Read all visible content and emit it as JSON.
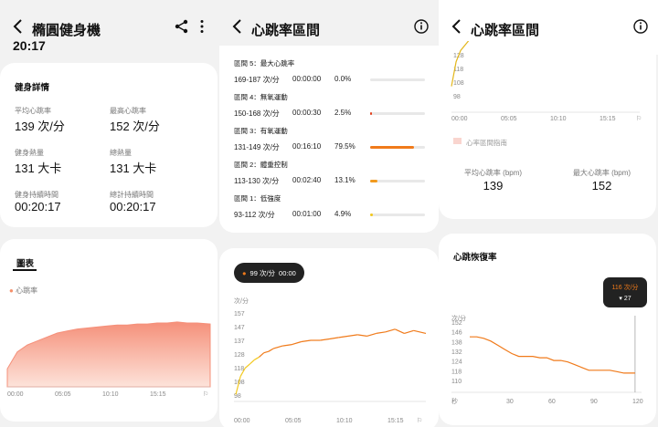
{
  "panel1": {
    "title": "橢圓健身機",
    "clipped_time": "20:17",
    "details": {
      "heading": "健身詳情",
      "avg_hr_label": "平均心跳率",
      "avg_hr_value": "139 次/分",
      "max_hr_label": "最高心跳率",
      "max_hr_value": "152 次/分",
      "calories_label": "健身熱量",
      "calories_value": "131 大卡",
      "total_cal_label": "總熱量",
      "total_cal_value": "131 大卡",
      "duration_label": "健身持續時間",
      "duration_value": "00:20:17",
      "total_duration_label": "總計持續時間",
      "total_duration_value": "00:20:17"
    },
    "chart_card": {
      "tab": "圖表",
      "legend": "心跳率",
      "x_ticks": [
        "00:00",
        "05:05",
        "10:10",
        "15:15"
      ]
    }
  },
  "panel2": {
    "title": "心跳率區間",
    "zones": [
      {
        "name": "區間 5：最大心跳率",
        "range": "169-187 次/分",
        "time": "00:00:00",
        "pct": "0.0%",
        "fraction": 0.0,
        "color": "#e0e0e0"
      },
      {
        "name": "區間 4：無氧運動",
        "range": "150-168 次/分",
        "time": "00:00:30",
        "pct": "2.5%",
        "fraction": 0.025,
        "color": "#e2401c"
      },
      {
        "name": "區間 3：有氧運動",
        "range": "131-149 次/分",
        "time": "00:16:10",
        "pct": "79.5%",
        "fraction": 0.795,
        "color": "#f07a1a"
      },
      {
        "name": "區間 2：體重控制",
        "range": "113-130 次/分",
        "time": "00:02:40",
        "pct": "13.1%",
        "fraction": 0.131,
        "color": "#f29a1e"
      },
      {
        "name": "區間 1：低強度",
        "range": "93-112 次/分",
        "time": "00:01:00",
        "pct": "4.9%",
        "fraction": 0.049,
        "color": "#f2c81e"
      }
    ],
    "tooltip": {
      "value": "99 次/分",
      "time": "00:00"
    },
    "y_unit": "次/分",
    "y_ticks": [
      "157",
      "147",
      "137",
      "128",
      "118",
      "108",
      "98"
    ],
    "x_ticks": [
      "00:00",
      "05:05",
      "10:10",
      "15:15"
    ]
  },
  "panel3": {
    "title": "心跳率區間",
    "top_chart": {
      "y_ticks": [
        "128",
        "118",
        "108",
        "98"
      ],
      "x_ticks": [
        "00:00",
        "05:05",
        "10:10",
        "15:15"
      ]
    },
    "legend": "心率區間指南",
    "avg_label": "平均心跳率 (bpm)",
    "avg_value": "139",
    "max_label": "最大心跳率 (bpm)",
    "max_value": "152",
    "recovery": {
      "heading": "心跳恢復率",
      "tooltip_value": "116 次/分",
      "tooltip_delta": "27",
      "y_unit": "次/分",
      "y_ticks": [
        "152",
        "146",
        "138",
        "132",
        "124",
        "118",
        "110"
      ],
      "x_unit": "秒",
      "x_ticks": [
        "30",
        "60",
        "90",
        "120"
      ]
    }
  },
  "chart_data": [
    {
      "type": "area",
      "ylabel": "心跳率",
      "x_minutes": [
        0,
        1,
        2,
        3,
        4,
        5,
        6,
        7,
        8,
        9,
        10,
        11,
        12,
        13,
        14,
        15,
        16,
        17,
        18,
        19,
        20.3
      ],
      "values": [
        98,
        115,
        122,
        126,
        130,
        134,
        136,
        138,
        139,
        140,
        141,
        142,
        142,
        143,
        143,
        144,
        144,
        145,
        144,
        144,
        143
      ]
    },
    {
      "type": "line",
      "ylabel": "次/分",
      "ylim": [
        98,
        157
      ],
      "x_minutes": [
        0,
        0.5,
        1,
        1.5,
        2,
        2.5,
        3,
        3.5,
        4,
        5,
        6,
        7,
        8,
        9,
        10,
        11,
        12,
        13,
        14,
        15,
        16,
        17,
        18,
        19,
        20.3
      ],
      "values": [
        99,
        112,
        118,
        121,
        124,
        126,
        129,
        130,
        132,
        134,
        135,
        137,
        138,
        138,
        139,
        140,
        141,
        142,
        141,
        143,
        144,
        146,
        143,
        145,
        143
      ],
      "zone_colors": {
        "low": "#f2c81e",
        "high": "#f07a1a"
      }
    },
    {
      "type": "line",
      "title": "心跳恢復率",
      "xlabel": "秒",
      "ylabel": "次/分",
      "ylim": [
        110,
        152
      ],
      "x_seconds": [
        0,
        5,
        10,
        15,
        20,
        25,
        30,
        35,
        40,
        45,
        50,
        55,
        60,
        65,
        70,
        75,
        80,
        85,
        90,
        95,
        100,
        105,
        110,
        115,
        118
      ],
      "values": [
        142,
        142,
        141,
        139,
        136,
        133,
        130,
        128,
        128,
        128,
        127,
        127,
        125,
        125,
        124,
        122,
        120,
        118,
        118,
        118,
        118,
        117,
        116,
        116,
        116
      ]
    }
  ]
}
